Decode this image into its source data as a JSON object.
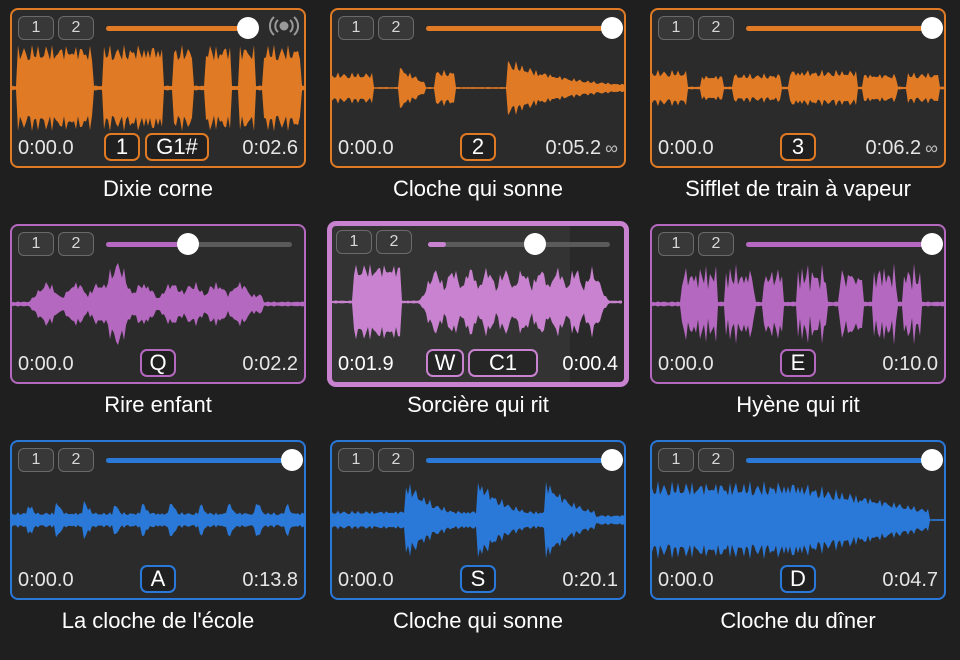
{
  "colors": {
    "orange": "#e07a24",
    "purple": "#b468bf",
    "purple_selected": "#c982d0",
    "blue": "#2a78d8"
  },
  "icons": {
    "broadcast": "broadcast-icon",
    "loop": "loop-icon"
  },
  "tiles": [
    {
      "name": "Dixie corne",
      "color": "orange",
      "volume": 1.0,
      "start": "0:00.0",
      "end": "0:02.6",
      "key": "1",
      "note": "G1#",
      "loop": false,
      "playing_icon": true
    },
    {
      "name": "Cloche qui sonne",
      "color": "orange",
      "volume": 1.0,
      "start": "0:00.0",
      "end": "0:05.2",
      "key": "2",
      "loop": true,
      "loop_symbol": "∞"
    },
    {
      "name": "Sifflet de train à vapeur",
      "color": "orange",
      "volume": 1.0,
      "start": "0:00.0",
      "end": "0:06.2",
      "key": "3",
      "loop": true,
      "loop_symbol": "∞"
    },
    {
      "name": "Rire enfant",
      "color": "purple",
      "volume": 0.44,
      "start": "0:00.0",
      "end": "0:02.2",
      "key": "Q"
    },
    {
      "name": "Sorcière qui rit",
      "color": "purple",
      "volume": 0.59,
      "playhead": 0.1,
      "selected": true,
      "start": "0:01.9",
      "end": "0:00.4",
      "key": "W",
      "note": "C1"
    },
    {
      "name": "Hyène qui rit",
      "color": "purple",
      "volume": 1.0,
      "start": "0:00.0",
      "end": "0:10.0",
      "key": "E"
    },
    {
      "name": "La cloche de l'école",
      "color": "blue",
      "volume": 1.0,
      "start": "0:00.0",
      "end": "0:13.8",
      "key": "A"
    },
    {
      "name": "Cloche qui sonne",
      "color": "blue",
      "volume": 1.0,
      "start": "0:00.0",
      "end": "0:20.1",
      "key": "S"
    },
    {
      "name": "Cloche du dîner",
      "color": "blue",
      "volume": 1.0,
      "start": "0:00.0",
      "end": "0:04.7",
      "key": "D"
    }
  ],
  "slot_labels": [
    "1",
    "2"
  ]
}
